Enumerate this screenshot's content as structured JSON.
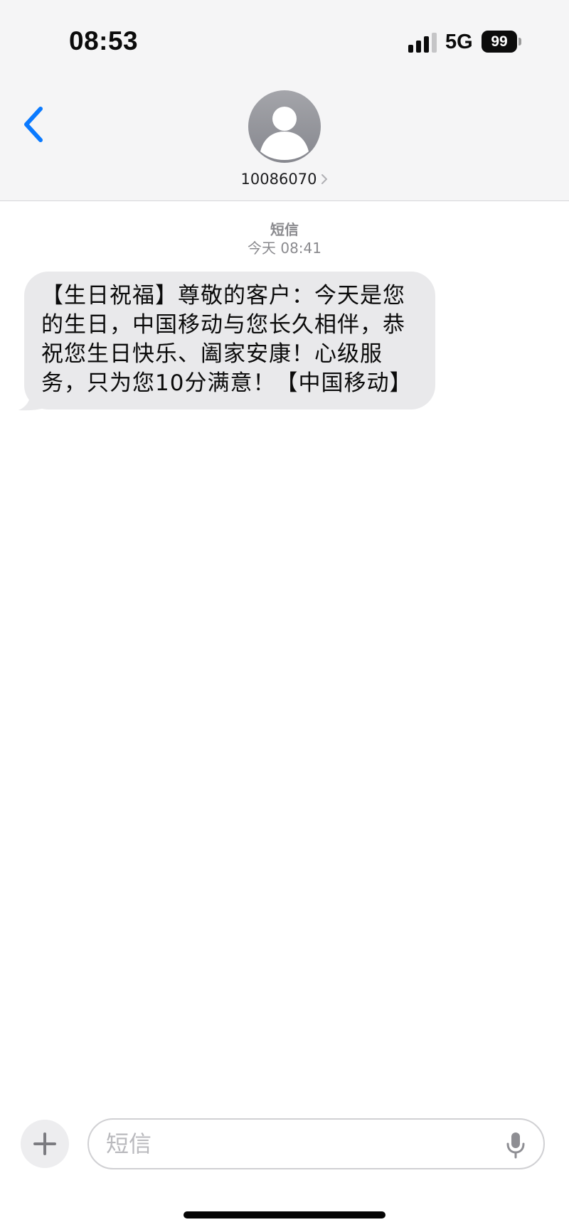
{
  "status_bar": {
    "time": "08:53",
    "network": "5G",
    "battery_level": "99",
    "icons": [
      "signal-icon",
      "battery-icon"
    ]
  },
  "nav": {
    "back_icon": "chevron-left-icon",
    "avatar_icon": "person-silhouette-icon",
    "contact_name": "10086070",
    "contact_chevron_icon": "chevron-right-icon"
  },
  "conversation": {
    "service_label": "短信",
    "timestamp": "今天 08:41",
    "messages": [
      {
        "direction": "incoming",
        "text": "【生日祝福】尊敬的客户：今天是您的生日，中国移动与您长久相伴，恭祝您生日快乐、阖家安康！心级服务，只为您10分满意！【中国移动】"
      }
    ]
  },
  "composer": {
    "plus_icon": "plus-icon",
    "placeholder": "短信",
    "value": "",
    "mic_icon": "microphone-icon"
  },
  "colors": {
    "accent": "#0a7aff",
    "header_bg": "#f5f5f6",
    "bubble_incoming": "#e9e9eb",
    "secondary_text": "#8a8a8e"
  }
}
